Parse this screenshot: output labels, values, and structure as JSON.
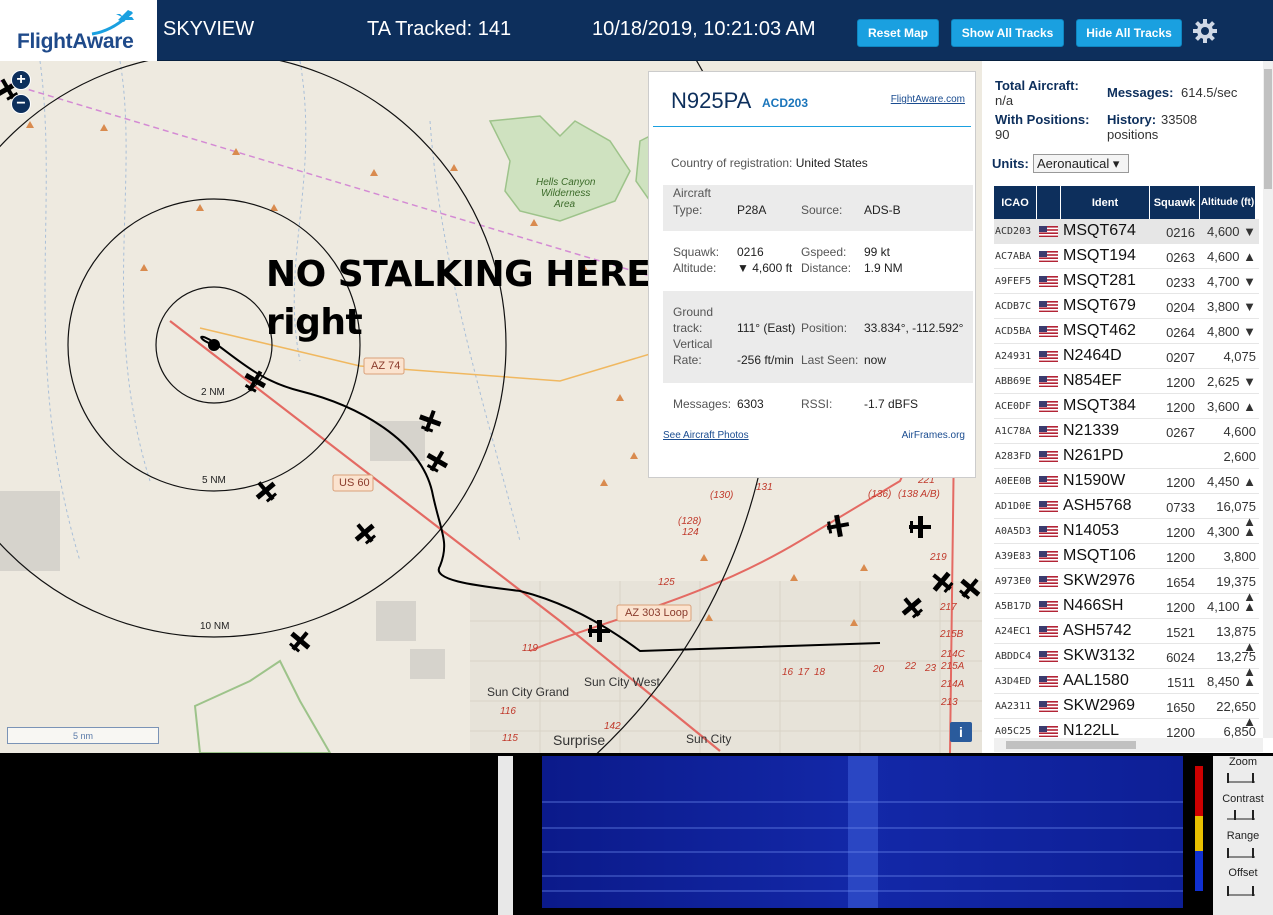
{
  "header": {
    "logo_text": "FlightAware",
    "app_name": "SKYVIEW",
    "tracked": "TA Tracked: 141",
    "datetime": "10/18/2019, 10:21:03 AM",
    "buttons": {
      "reset_map": "Reset Map",
      "show_all": "Show All Tracks",
      "hide_all": "Hide All Tracks"
    },
    "icons": {
      "logo": "flightaware-plane-icon",
      "settings": "gear-icon"
    }
  },
  "map": {
    "overlay_text_line1": "NO STALKING HERE",
    "overlay_text_line2": "right",
    "range_labels": [
      "2 NM",
      "5 NM",
      "10 NM"
    ],
    "road_labels": [
      "US 60",
      "AZ 74",
      "AZ 303 Loop",
      "(130)",
      "131",
      "(136)",
      "(138 A/B)",
      "(128)",
      "124",
      "125",
      "119",
      "221",
      "219",
      "217",
      "215B",
      "214C",
      "215A",
      "214A",
      "213",
      "22",
      "23",
      "20",
      "16",
      "17",
      "18",
      "115",
      "116",
      "142"
    ],
    "place_labels": [
      "Hells Canyon",
      "Wilderness",
      "Area",
      "Sun City Grand",
      "Sun City West",
      "Surprise",
      "Sun City"
    ],
    "scale_label": "5 nm",
    "info_icon": "i",
    "zoom_in": "+",
    "zoom_out": "−"
  },
  "popup": {
    "registration": "N925PA",
    "icao": "ACD203",
    "fa_link": "FlightAware.com",
    "country_label": "Country of registration:",
    "country_value": "United States",
    "aircraft_type_label1": "Aircraft",
    "aircraft_type_label2": "Type:",
    "aircraft_type_value": "P28A",
    "source_label": "Source:",
    "source_value": "ADS-B",
    "squawk_label": "Squawk:",
    "squawk_value": "0216",
    "gspeed_label": "Gspeed:",
    "gspeed_value": "99 kt",
    "altitude_label": "Altitude:",
    "altitude_value": "▼ 4,600 ft",
    "distance_label": "Distance:",
    "distance_value": "1.9 NM",
    "ground_label1": "Ground",
    "ground_label2": "track:",
    "ground_value": "111° (East)",
    "position_label": "Position:",
    "position_value": "33.834°, -112.592°",
    "vert_label1": "Vertical",
    "vert_label2": "Rate:",
    "vert_value": "-256 ft/min",
    "last_seen_label": "Last Seen:",
    "last_seen_value": "now",
    "messages_label": "Messages:",
    "messages_value": "6303",
    "rssi_label": "RSSI:",
    "rssi_value": "-1.7 dBFS",
    "photos_link": "See Aircraft Photos",
    "airframes_link": "AirFrames.org"
  },
  "panel": {
    "total_label": "Total Aircraft:",
    "total_value": "n/a",
    "messages_label": "Messages:",
    "messages_value": "614.5/sec",
    "positions_label": "With Positions:",
    "positions_value": "90",
    "history_label": "History:",
    "history_value1": "33508",
    "history_value2": "positions",
    "units_label": "Units:",
    "units_value": "Aeronautical ▾",
    "columns": [
      "ICAO",
      "",
      "Ident",
      "Squawk",
      "Altitude (ft)"
    ],
    "rows": [
      {
        "icao": "ACD203",
        "ident": "MSQT674",
        "squawk": "0216",
        "alt": "4,600 ▼"
      },
      {
        "icao": "AC7ABA",
        "ident": "MSQT194",
        "squawk": "0263",
        "alt": "4,600 ▲"
      },
      {
        "icao": "A9FEF5",
        "ident": "MSQT281",
        "squawk": "0233",
        "alt": "4,700 ▼"
      },
      {
        "icao": "ACDB7C",
        "ident": "MSQT679",
        "squawk": "0204",
        "alt": "3,800 ▼"
      },
      {
        "icao": "ACD5BA",
        "ident": "MSQT462",
        "squawk": "0264",
        "alt": "4,800 ▼"
      },
      {
        "icao": "A24931",
        "ident": "N2464D",
        "squawk": "0207",
        "alt": "4,075"
      },
      {
        "icao": "ABB69E",
        "ident": "N854EF",
        "squawk": "1200",
        "alt": "2,625 ▼"
      },
      {
        "icao": "ACE0DF",
        "ident": "MSQT384",
        "squawk": "1200",
        "alt": "3,600 ▲"
      },
      {
        "icao": "A1C78A",
        "ident": "N21339",
        "squawk": "0267",
        "alt": "4,600"
      },
      {
        "icao": "A283FD",
        "ident": "N261PD",
        "squawk": "",
        "alt": "2,600"
      },
      {
        "icao": "A0EE0B",
        "ident": "N1590W",
        "squawk": "1200",
        "alt": "4,450 ▲"
      },
      {
        "icao": "AD1D0E",
        "ident": "ASH5768",
        "squawk": "0733",
        "alt": "16,075 ▲"
      },
      {
        "icao": "A0A5D3",
        "ident": "N14053",
        "squawk": "1200",
        "alt": "4,300 ▲"
      },
      {
        "icao": "A39E83",
        "ident": "MSQT106",
        "squawk": "1200",
        "alt": "3,800"
      },
      {
        "icao": "A973E0",
        "ident": "SKW2976",
        "squawk": "1654",
        "alt": "19,375 ▲"
      },
      {
        "icao": "A5B17D",
        "ident": "N466SH",
        "squawk": "1200",
        "alt": "4,100 ▲"
      },
      {
        "icao": "A24EC1",
        "ident": "ASH5742",
        "squawk": "1521",
        "alt": "13,875 ▲"
      },
      {
        "icao": "ABDDC4",
        "ident": "SKW3132",
        "squawk": "6024",
        "alt": "13,275 ▲"
      },
      {
        "icao": "A3D4ED",
        "ident": "AAL1580",
        "squawk": "1511",
        "alt": "8,450 ▲"
      },
      {
        "icao": "AA2311",
        "ident": "SKW2969",
        "squawk": "1650",
        "alt": "22,650 ▲"
      },
      {
        "icao": "A05C25",
        "ident": "N122LL",
        "squawk": "1200",
        "alt": "6,850"
      }
    ]
  },
  "spectrum": {
    "controls": [
      "Zoom",
      "Contrast",
      "Range",
      "Offset"
    ]
  },
  "colors": {
    "header_bg": "#0d2f5c",
    "button_bg": "#1aa0e0",
    "map_bg": "#eeeae0"
  }
}
